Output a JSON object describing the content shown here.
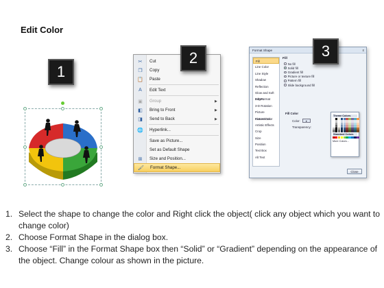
{
  "page": {
    "title": "Edit Color"
  },
  "badges": [
    "1",
    "2",
    "3"
  ],
  "colors": {
    "badge_bg": "#1a1a1a",
    "menu_highlight": "#f8cf5f",
    "puzzle_red": "#d62a2a",
    "puzzle_blue": "#2a6fc9",
    "puzzle_green": "#3aa63a",
    "puzzle_yellow": "#f2c40d"
  },
  "context_menu": {
    "items": [
      {
        "label": "Cut",
        "icon": "scissors-icon",
        "state": "normal",
        "submenu": false
      },
      {
        "label": "Copy",
        "icon": "copy-icon",
        "state": "normal",
        "submenu": false
      },
      {
        "label": "Paste",
        "icon": "paste-icon",
        "state": "normal",
        "submenu": false
      },
      {
        "label": "Edit Text",
        "icon": "edit-text-icon",
        "state": "normal",
        "submenu": false
      },
      {
        "label": "Group",
        "icon": "group-icon",
        "state": "disabled",
        "submenu": true
      },
      {
        "label": "Bring to Front",
        "icon": "bring-front-icon",
        "state": "normal",
        "submenu": true
      },
      {
        "label": "Send to Back",
        "icon": "send-back-icon",
        "state": "normal",
        "submenu": true
      },
      {
        "label": "Hyperlink...",
        "icon": "hyperlink-icon",
        "state": "normal",
        "submenu": false
      },
      {
        "label": "Save as Picture...",
        "icon": "",
        "state": "normal",
        "submenu": false
      },
      {
        "label": "Set as Default Shape",
        "icon": "",
        "state": "normal",
        "submenu": false
      },
      {
        "label": "Size and Position...",
        "icon": "size-position-icon",
        "state": "normal",
        "submenu": false
      },
      {
        "label": "Format Shape...",
        "icon": "format-shape-icon",
        "state": "highlighted",
        "submenu": false
      }
    ]
  },
  "format_dialog": {
    "title": "Format Shape",
    "close_x": "x",
    "categories": [
      "Fill",
      "Line Color",
      "Line Style",
      "Shadow",
      "Reflection",
      "Glow and Soft Edges",
      "3-D Format",
      "3-D Rotation",
      "Picture Corrections",
      "Picture Color",
      "Artistic Effects",
      "Crop",
      "Size",
      "Position",
      "Text Box",
      "Alt Text"
    ],
    "selected_category": "Fill",
    "fill_heading": "Fill",
    "fill_options": [
      "No fill",
      "Solid fill",
      "Gradient fill",
      "Picture or texture fill",
      "Pattern fill",
      "Slide background fill"
    ],
    "selected_fill": "Solid fill",
    "fill_color_heading": "Fill Color",
    "color_label": "Color:",
    "transparency_label": "Transparency:",
    "theme_colors_label": "Theme Colors",
    "standard_colors_label": "Standard Colors",
    "more_colors_label": "More Colors...",
    "close_label": "Close",
    "theme_colors": [
      "#ffffff",
      "#000000",
      "#eeece1",
      "#1f497d",
      "#4f81bd",
      "#c0504d",
      "#9bbb59",
      "#8064a2",
      "#4bacc6",
      "#f79646"
    ],
    "standard_colors": [
      "#c00000",
      "#ff0000",
      "#ffc000",
      "#ffff00",
      "#92d050",
      "#00b050",
      "#00b0f0",
      "#0070c0",
      "#002060",
      "#7030a0"
    ]
  },
  "instructions": [
    {
      "num": "1.",
      "text": "Select the shape to change the color and Right click the object( click any object which you want to change color)"
    },
    {
      "num": "2.",
      "text": "Choose Format Shape in the dialog box."
    },
    {
      "num": "3.",
      "text": "Choose “Fill” in the Format Shape box then “Solid” or “Gradient” depending on the appearance of the object. Change colour as shown in the picture."
    }
  ]
}
